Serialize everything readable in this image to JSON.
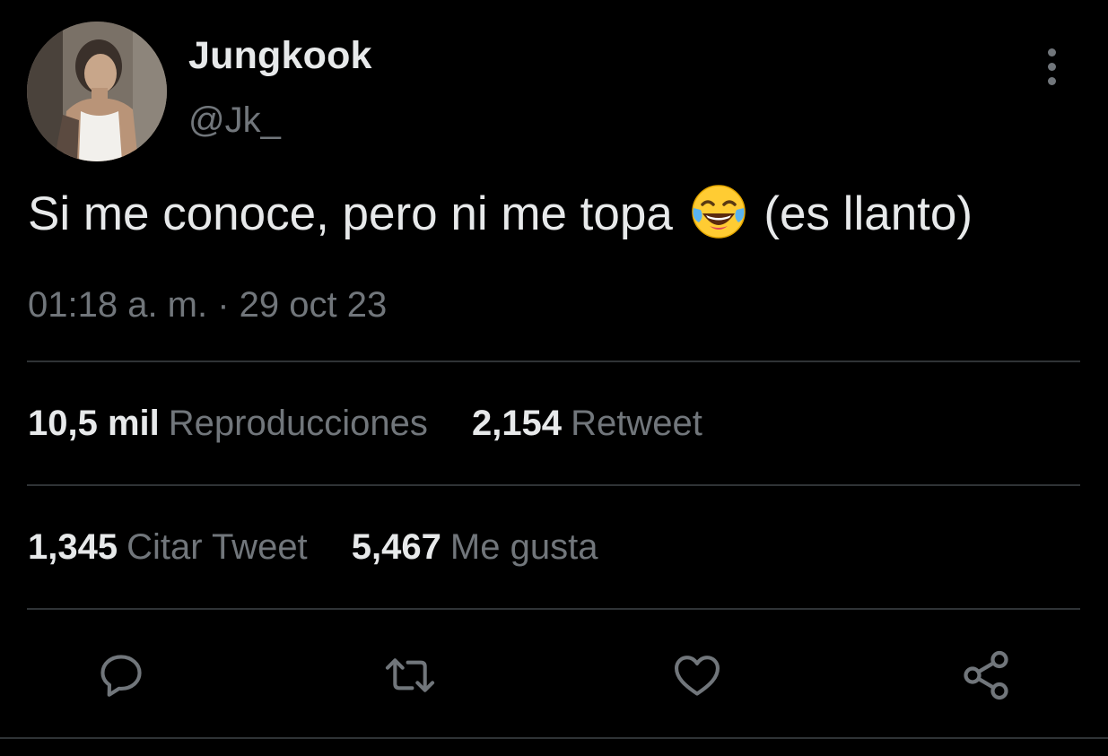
{
  "user": {
    "display_name": "Jungkook",
    "handle": "@Jk_"
  },
  "tweet": {
    "text_before_emoji": "Si me conoce, pero ni me topa",
    "emoji": "face-with-tears-of-joy",
    "text_after_emoji": "(es llanto)",
    "timestamp": "01:18 a. m. · 29 oct 23"
  },
  "stats": {
    "views_count": "10,5 mil",
    "views_label": "Reproducciones",
    "retweets_count": "2,154",
    "retweets_label": "Retweet",
    "quotes_count": "1,345",
    "quotes_label": "Citar Tweet",
    "likes_count": "5,467",
    "likes_label": "Me gusta"
  },
  "actions": {
    "reply_icon": "reply-icon",
    "retweet_icon": "retweet-icon",
    "like_icon": "heart-icon",
    "share_icon": "share-icon"
  },
  "colors": {
    "background": "#000000",
    "primary_text": "#e7e9ea",
    "secondary_text": "#71767b",
    "divider": "#2f3336"
  }
}
